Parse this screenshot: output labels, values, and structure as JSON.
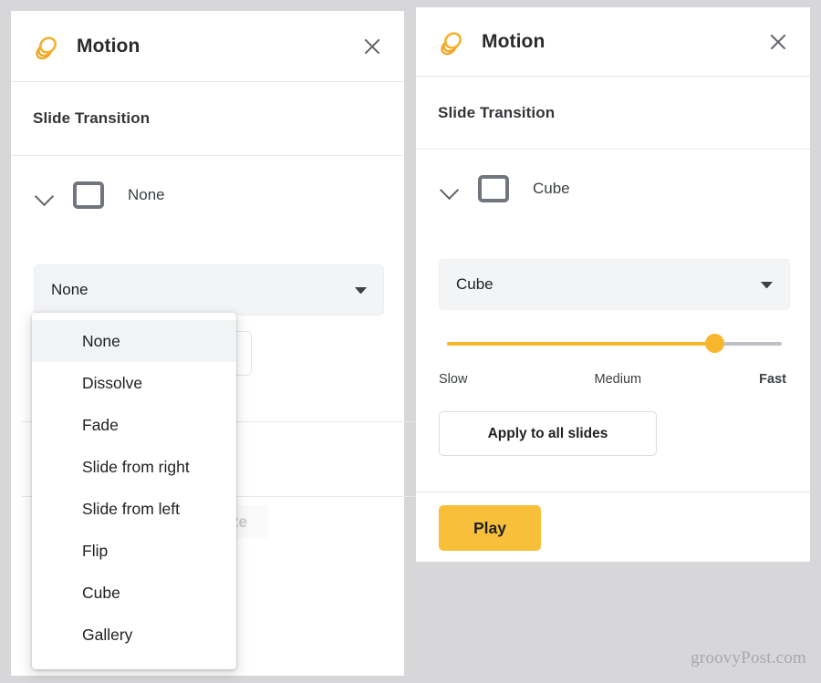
{
  "background_color": "#d7d6d8",
  "accent_color": "#f8c03a",
  "panels": {
    "left": {
      "title": "Motion",
      "app_icon": "motion-stack-icon",
      "close_icon": "close-icon",
      "section_heading": "Slide Transition",
      "transition_row": {
        "chevron_icon": "chevron-down-icon",
        "slide_icon": "slide-thumbnail-icon",
        "label": "None"
      },
      "select": {
        "value": "None",
        "caret_icon": "caret-down-icon"
      },
      "dropdown_open": true,
      "dropdown_options": [
        "None",
        "Dissolve",
        "Fade",
        "Slide from right",
        "Slide from left",
        "Flip",
        "Cube",
        "Gallery"
      ],
      "dropdown_selected": "None",
      "obscured": {
        "animate_label": "animate"
      }
    },
    "right": {
      "title": "Motion",
      "app_icon": "motion-stack-icon",
      "close_icon": "close-icon",
      "section_heading": "Slide Transition",
      "transition_row": {
        "chevron_icon": "chevron-down-icon",
        "slide_icon": "slide-thumbnail-icon",
        "label": "Cube"
      },
      "select": {
        "value": "Cube",
        "caret_icon": "caret-down-icon"
      },
      "speed_slider": {
        "value_percent": 80,
        "min_label": "Slow",
        "mid_label": "Medium",
        "max_label": "Fast"
      },
      "apply_button": "Apply to all slides",
      "play_button": "Play"
    }
  },
  "watermark": "groovyPost.com"
}
